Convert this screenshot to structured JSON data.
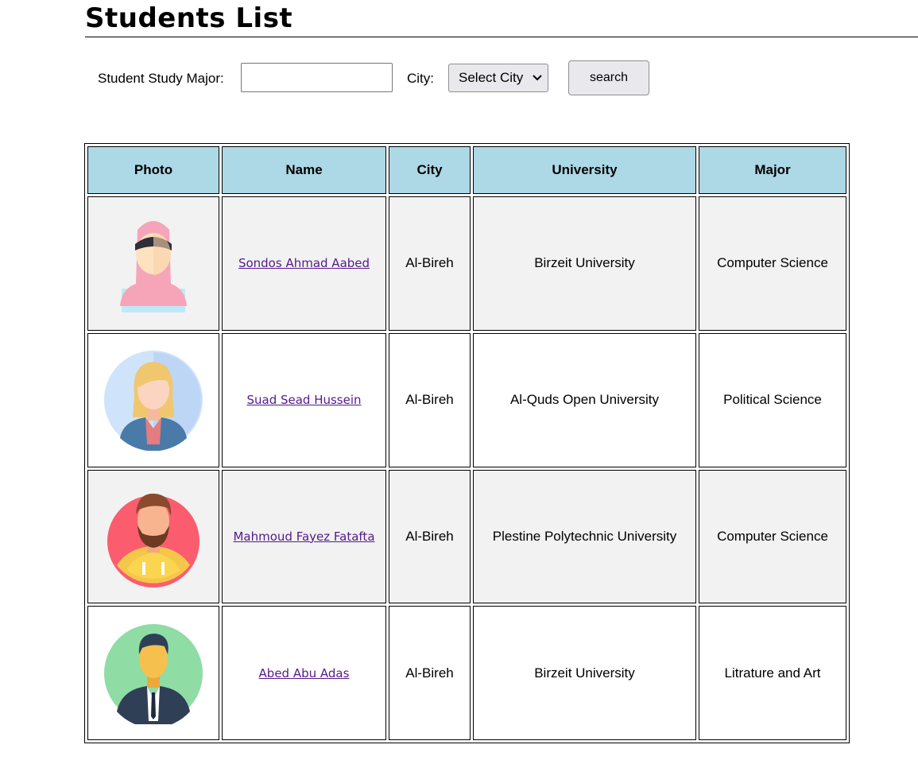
{
  "page": {
    "title": "Students List"
  },
  "filters": {
    "major_label": "Student Study Major:",
    "major_value": "",
    "city_label": "City:",
    "city_selected": "Select City",
    "search_label": "search"
  },
  "table": {
    "headers": [
      "Photo",
      "Name",
      "City",
      "University",
      "Major"
    ],
    "rows": [
      {
        "photo": "avatar-woman-hijab-icon",
        "name": "Sondos Ahmad Aabed",
        "city": "Al-Bireh",
        "university": "Birzeit University",
        "major": "Computer Science"
      },
      {
        "photo": "avatar-woman-blonde-icon",
        "name": "Suad Sead Hussein",
        "city": "Al-Bireh",
        "university": "Al-Quds Open University",
        "major": "Political Science"
      },
      {
        "photo": "avatar-man-beard-icon",
        "name": "Mahmoud Fayez Fatafta",
        "city": "Al-Bireh",
        "university": "Plestine Polytechnic University",
        "major": "Computer Science"
      },
      {
        "photo": "avatar-man-suit-icon",
        "name": "Abed Abu Adas",
        "city": "Al-Bireh",
        "university": "Birzeit University",
        "major": "Litrature and Art"
      }
    ]
  },
  "colors": {
    "header_bg": "#add8e6",
    "odd_row_bg": "#f2f2f2",
    "link": "#551a8b"
  }
}
